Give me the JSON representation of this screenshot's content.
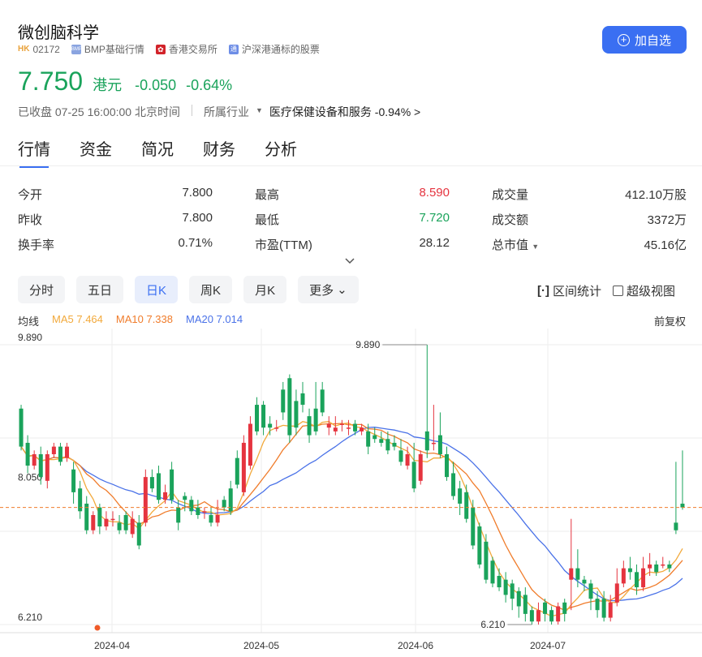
{
  "header": {
    "name": "微创脑科学",
    "exchange_badge": "HK",
    "code": "02172",
    "bmp_label": "BMP基础行情",
    "hkex_label": "香港交易所",
    "connect_label": "沪深港通标的股票",
    "watch_button": "加自选"
  },
  "quote": {
    "price": "7.750",
    "currency": "港元",
    "change": "-0.050",
    "change_pct": "-0.64%",
    "status": "已收盘 07-25 16:00:00 北京时间",
    "industry_label": "所属行业",
    "industry_name": "医疗保健设备和服务",
    "industry_change": "-0.94%"
  },
  "tabs": [
    "行情",
    "资金",
    "简况",
    "财务",
    "分析"
  ],
  "stats": [
    [
      {
        "label": "今开",
        "value": "7.800"
      },
      {
        "label": "最高",
        "value": "8.590"
      },
      {
        "label": "成交量",
        "value": "412.10万股"
      }
    ],
    [
      {
        "label": "昨收",
        "value": "7.800"
      },
      {
        "label": "最低",
        "value": "7.720"
      },
      {
        "label": "成交额",
        "value": "3372万"
      }
    ],
    [
      {
        "label": "换手率",
        "value": "0.71%"
      },
      {
        "label": "市盈(TTM)",
        "value": "28.12"
      },
      {
        "label": "总市值",
        "value": "45.16亿"
      }
    ]
  ],
  "periods": [
    "分时",
    "五日",
    "日K",
    "周K",
    "月K",
    "更多"
  ],
  "tools": {
    "range": "区间统计",
    "super": "超级视图"
  },
  "ma": {
    "label": "均线",
    "ma5": "MA5 7.464",
    "ma10": "MA10 7.338",
    "ma20": "MA20 7.014",
    "adjust": "前复权"
  },
  "colors": {
    "up": "#e5343f",
    "down": "#1aa35b",
    "ma5": "#f2a93b",
    "ma10": "#f07c2b",
    "ma20": "#4a72e8",
    "accent": "#3a6ff2"
  },
  "chart_data": {
    "type": "candlestick",
    "y_ticks": [
      "9.890",
      "8.050",
      "6.210"
    ],
    "x_ticks": [
      "2024-04",
      "2024-05",
      "2024-06",
      "2024-07"
    ],
    "ylim": [
      6.21,
      9.89
    ],
    "annotations": {
      "max": "9.890",
      "min": "6.210"
    },
    "last_close": 7.75,
    "candles": [
      [
        9.05,
        8.55,
        9.1,
        8.5
      ],
      [
        8.6,
        8.3,
        8.7,
        8.2
      ],
      [
        8.3,
        8.45,
        8.5,
        8.25
      ],
      [
        8.45,
        8.15,
        8.55,
        8.05
      ],
      [
        8.1,
        8.45,
        8.5,
        8.0
      ],
      [
        8.45,
        8.55,
        8.6,
        8.4
      ],
      [
        8.55,
        8.35,
        8.6,
        8.3
      ],
      [
        8.4,
        8.55,
        8.6,
        8.35
      ],
      [
        8.25,
        7.95,
        8.35,
        7.8
      ],
      [
        8.0,
        7.7,
        8.1,
        7.6
      ],
      [
        7.8,
        7.45,
        7.9,
        7.4
      ],
      [
        7.45,
        7.65,
        7.7,
        7.4
      ],
      [
        7.75,
        7.5,
        7.8,
        7.4
      ],
      [
        7.5,
        7.6,
        7.7,
        7.45
      ],
      [
        7.6,
        7.6,
        7.7,
        7.5
      ],
      [
        7.55,
        7.45,
        7.65,
        7.4
      ],
      [
        7.65,
        7.45,
        7.7,
        7.4
      ],
      [
        7.4,
        7.6,
        7.7,
        7.35
      ],
      [
        7.55,
        7.25,
        7.65,
        7.2
      ],
      [
        7.55,
        8.15,
        8.25,
        7.5
      ],
      [
        8.15,
        8.0,
        8.25,
        7.95
      ],
      [
        8.2,
        7.85,
        8.3,
        7.8
      ],
      [
        7.85,
        7.95,
        8.05,
        7.8
      ],
      [
        8.25,
        7.85,
        8.35,
        7.8
      ],
      [
        7.75,
        7.55,
        7.85,
        7.45
      ],
      [
        7.9,
        7.85,
        7.95,
        7.7
      ],
      [
        7.85,
        7.7,
        7.9,
        7.65
      ],
      [
        7.75,
        7.65,
        7.85,
        7.6
      ],
      [
        7.7,
        7.7,
        7.75,
        7.6
      ],
      [
        7.65,
        7.55,
        7.75,
        7.5
      ],
      [
        7.55,
        7.65,
        7.85,
        7.5
      ],
      [
        7.85,
        7.75,
        7.9,
        7.7
      ],
      [
        8.0,
        7.7,
        8.1,
        7.65
      ],
      [
        8.4,
        8.05,
        8.5,
        8.0
      ],
      [
        7.95,
        8.6,
        8.7,
        7.9
      ],
      [
        8.3,
        8.85,
        8.95,
        8.25
      ],
      [
        9.1,
        8.75,
        9.2,
        8.7
      ],
      [
        9.1,
        8.8,
        9.15,
        8.7
      ],
      [
        8.85,
        8.8,
        8.95,
        8.7
      ],
      [
        8.8,
        8.8,
        8.9,
        8.75
      ],
      [
        9.3,
        9.0,
        9.4,
        8.9
      ],
      [
        9.45,
        8.7,
        9.5,
        8.6
      ],
      [
        9.15,
        8.8,
        9.3,
        8.7
      ],
      [
        9.25,
        9.1,
        9.4,
        9.0
      ],
      [
        8.95,
        8.7,
        9.05,
        8.6
      ],
      [
        9.05,
        8.75,
        9.4,
        8.7
      ],
      [
        9.3,
        9.0,
        9.4,
        8.95
      ],
      [
        8.8,
        8.85,
        8.95,
        8.7
      ],
      [
        8.75,
        8.8,
        8.95,
        8.7
      ],
      [
        8.85,
        8.85,
        8.9,
        8.75
      ],
      [
        8.8,
        8.8,
        8.9,
        8.7
      ],
      [
        8.85,
        8.75,
        8.9,
        8.7
      ],
      [
        8.75,
        8.8,
        8.85,
        8.7
      ],
      [
        8.75,
        8.55,
        8.85,
        8.45
      ],
      [
        8.7,
        8.65,
        8.8,
        8.6
      ],
      [
        8.65,
        8.6,
        8.75,
        8.55
      ],
      [
        8.65,
        8.5,
        8.75,
        8.45
      ],
      [
        8.6,
        8.55,
        8.7,
        8.5
      ],
      [
        8.5,
        8.35,
        8.65,
        8.3
      ],
      [
        8.3,
        8.45,
        8.55,
        8.25
      ],
      [
        8.35,
        8.0,
        8.6,
        7.95
      ],
      [
        8.1,
        8.45,
        8.5,
        8.05
      ],
      [
        8.75,
        8.5,
        9.89,
        8.4
      ],
      [
        8.6,
        8.6,
        9.1,
        8.5
      ],
      [
        8.7,
        8.45,
        9.0,
        8.4
      ],
      [
        8.45,
        8.15,
        8.55,
        8.1
      ],
      [
        8.2,
        7.9,
        8.35,
        7.85
      ],
      [
        8.0,
        7.8,
        8.1,
        7.65
      ],
      [
        7.95,
        7.6,
        8.05,
        7.55
      ],
      [
        7.75,
        7.25,
        7.85,
        7.2
      ],
      [
        7.5,
        7.0,
        7.55,
        6.95
      ],
      [
        7.3,
        6.8,
        7.4,
        6.75
      ],
      [
        7.05,
        6.75,
        7.1,
        6.7
      ],
      [
        6.85,
        6.7,
        6.95,
        6.65
      ],
      [
        6.8,
        6.6,
        6.9,
        6.5
      ],
      [
        6.75,
        6.55,
        6.8,
        6.4
      ],
      [
        6.65,
        6.45,
        6.7,
        6.3
      ],
      [
        6.6,
        6.35,
        6.7,
        6.25
      ],
      [
        6.4,
        6.25,
        6.45,
        6.21
      ],
      [
        6.25,
        6.4,
        6.5,
        6.21
      ],
      [
        6.5,
        6.35,
        6.55,
        6.25
      ],
      [
        6.4,
        6.25,
        6.45,
        6.21
      ],
      [
        6.25,
        6.45,
        6.5,
        6.21
      ],
      [
        6.5,
        6.35,
        6.55,
        6.25
      ],
      [
        6.8,
        6.95,
        7.6,
        6.4
      ],
      [
        6.95,
        6.8,
        7.2,
        6.7
      ],
      [
        6.8,
        6.75,
        6.85,
        6.65
      ],
      [
        6.75,
        6.55,
        6.8,
        6.4
      ],
      [
        6.55,
        6.4,
        6.65,
        6.3
      ],
      [
        6.55,
        6.3,
        6.65,
        6.25
      ],
      [
        6.3,
        6.5,
        6.6,
        6.25
      ],
      [
        6.5,
        6.75,
        6.95,
        6.45
      ],
      [
        6.75,
        6.95,
        7.05,
        6.7
      ],
      [
        6.95,
        6.9,
        7.1,
        6.8
      ],
      [
        6.9,
        6.7,
        7.0,
        6.6
      ],
      [
        6.7,
        6.95,
        7.1,
        6.65
      ],
      [
        6.95,
        7.0,
        7.15,
        6.85
      ],
      [
        7.0,
        6.9,
        7.05,
        6.85
      ],
      [
        7.0,
        7.0,
        7.1,
        6.95
      ],
      [
        7.0,
        6.95,
        7.05,
        6.9
      ],
      [
        7.55,
        7.45,
        8.35,
        7.4
      ],
      [
        7.8,
        7.75,
        8.5,
        7.72
      ]
    ]
  }
}
